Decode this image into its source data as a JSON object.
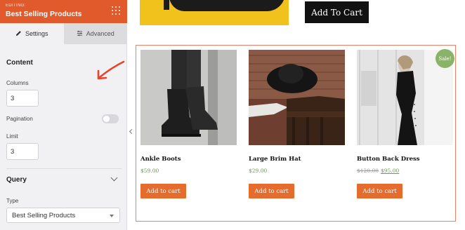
{
  "panel": {
    "editing_label": "EDITING:",
    "title": "Best Selling Products",
    "tabs": [
      {
        "label": "Settings",
        "icon": "pencil-icon",
        "active": true
      },
      {
        "label": "Advanced",
        "icon": "sliders-icon",
        "active": false
      }
    ],
    "content_section": "Content",
    "columns_label": "Columns",
    "columns_value": "3",
    "pagination_label": "Pagination",
    "pagination_enabled": false,
    "limit_label": "Limit",
    "limit_value": "3",
    "query_section": "Query",
    "type_label": "Type",
    "type_value": "Best Selling Products"
  },
  "content": {
    "top_add_to_cart": "Add To Cart",
    "products": [
      {
        "name": "Ankle Boots",
        "price": "$59.00",
        "old_price": "",
        "on_sale": false,
        "button": "Add to cart"
      },
      {
        "name": "Large Brim Hat",
        "price": "$29.00",
        "old_price": "",
        "on_sale": false,
        "button": "Add to cart"
      },
      {
        "name": "Button Back Dress",
        "price": "$95.00",
        "old_price": "$120.00",
        "on_sale": true,
        "sale_label": "Sale!",
        "button": "Add to cart"
      }
    ]
  },
  "colors": {
    "header": "#e05a2b",
    "button": "#e56c2d",
    "frame": "#e8826a",
    "price": "#6a9a4c",
    "sale": "#8ab36a",
    "annotation": "#e8432b"
  }
}
